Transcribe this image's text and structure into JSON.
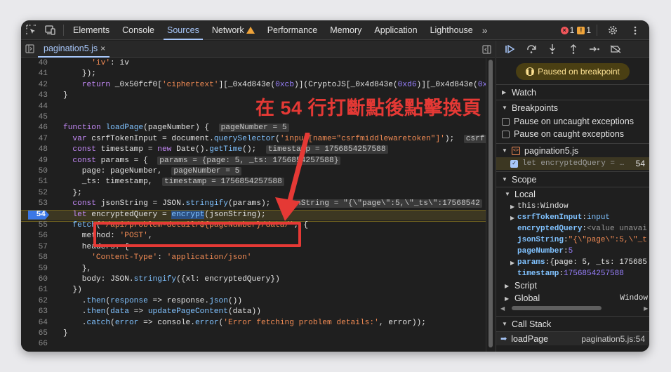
{
  "toolbar": {
    "tabs": [
      {
        "label": "Elements"
      },
      {
        "label": "Console"
      },
      {
        "label": "Sources"
      },
      {
        "label": "Network"
      },
      {
        "label": "Performance"
      },
      {
        "label": "Memory"
      },
      {
        "label": "Application"
      },
      {
        "label": "Lighthouse"
      }
    ],
    "error_count": "1",
    "warning_count": "1"
  },
  "editor": {
    "file_tab": "pagination5.js",
    "file_close": "×",
    "lines": [
      {
        "n": "40",
        "t": "'iv': iv"
      },
      {
        "n": "41",
        "t": "});"
      },
      {
        "n": "42",
        "t": "return _0x50fcf0['ciphertext'][_0x4d843e(0xcb)](CryptoJS[_0x4d843e(0xd6)][_0x4d843e(0xc"
      },
      {
        "n": "43",
        "t": "}"
      },
      {
        "n": "44",
        "t": ""
      },
      {
        "n": "45",
        "t": ""
      },
      {
        "n": "46",
        "t": "function loadPage(pageNumber) {",
        "inline": "pageNumber = 5"
      },
      {
        "n": "47",
        "t": "var csrfTokenInput = document.querySelector('input[name=\"csrfmiddlewaretoken\"]');",
        "inline": "csrf"
      },
      {
        "n": "48",
        "t": "const timestamp = new Date().getTime();",
        "inline": "timestamp = 1756854257588"
      },
      {
        "n": "49",
        "t": "const params = {",
        "inline": "params = {page: 5, _ts: 1756854257588}"
      },
      {
        "n": "50",
        "t": "page: pageNumber,",
        "inline": "pageNumber = 5"
      },
      {
        "n": "51",
        "t": "_ts: timestamp,",
        "inline": "timestamp = 1756854257588"
      },
      {
        "n": "52",
        "t": "};"
      },
      {
        "n": "53",
        "t": "const jsonString = JSON.stringify(params);",
        "inline": "jsonString = \"{\\\"page\\\":5,\\\"_ts\\\":17568542"
      },
      {
        "n": "54",
        "t": "let encryptedQuery = encrypt(jsonString);"
      },
      {
        "n": "55",
        "t": "fetch(`/api/problem-detail/${pageNumber}/data/`, {"
      },
      {
        "n": "56",
        "t": "method: 'POST',"
      },
      {
        "n": "57",
        "t": "headers: {"
      },
      {
        "n": "58",
        "t": "'Content-Type': 'application/json'"
      },
      {
        "n": "59",
        "t": "},"
      },
      {
        "n": "60",
        "t": "body: JSON.stringify({xl: encryptedQuery})"
      },
      {
        "n": "61",
        "t": "})"
      },
      {
        "n": "62",
        "t": ".then(response => response.json())"
      },
      {
        "n": "63",
        "t": ".then(data => updatePageContent(data))"
      },
      {
        "n": "64",
        "t": ".catch(error => console.error('Error fetching problem details:', error));"
      },
      {
        "n": "65",
        "t": "}"
      },
      {
        "n": "66",
        "t": ""
      }
    ]
  },
  "annotation": "在 54 行打斷點後點擊換頁",
  "sidebar": {
    "paused": "Paused on breakpoint",
    "watch": "Watch",
    "breakpoints": "Breakpoints",
    "uncaught": "Pause on uncaught exceptions",
    "caught": "Pause on caught exceptions",
    "bp_file": "pagination5.js",
    "bp_code": "let encryptedQuery = …",
    "bp_line": "54",
    "scope": "Scope",
    "local": "Local",
    "scope_items": [
      {
        "k": "this",
        "v": "Window"
      },
      {
        "k": "csrfTokenInput",
        "v": "input"
      },
      {
        "k": "encryptedQuery",
        "v": "<value unavai"
      },
      {
        "k": "jsonString",
        "v": "\"{\\\"page\\\":5,\\\"_t"
      },
      {
        "k": "pageNumber",
        "v": "5"
      },
      {
        "k": "params",
        "v": "{page: 5, _ts: 175685"
      },
      {
        "k": "timestamp",
        "v": "1756854257588"
      }
    ],
    "script": "Script",
    "global": "Global",
    "global_val": "Window",
    "call_stack": "Call Stack",
    "stack_fn": "loadPage",
    "stack_loc": "pagination5.js:54"
  }
}
